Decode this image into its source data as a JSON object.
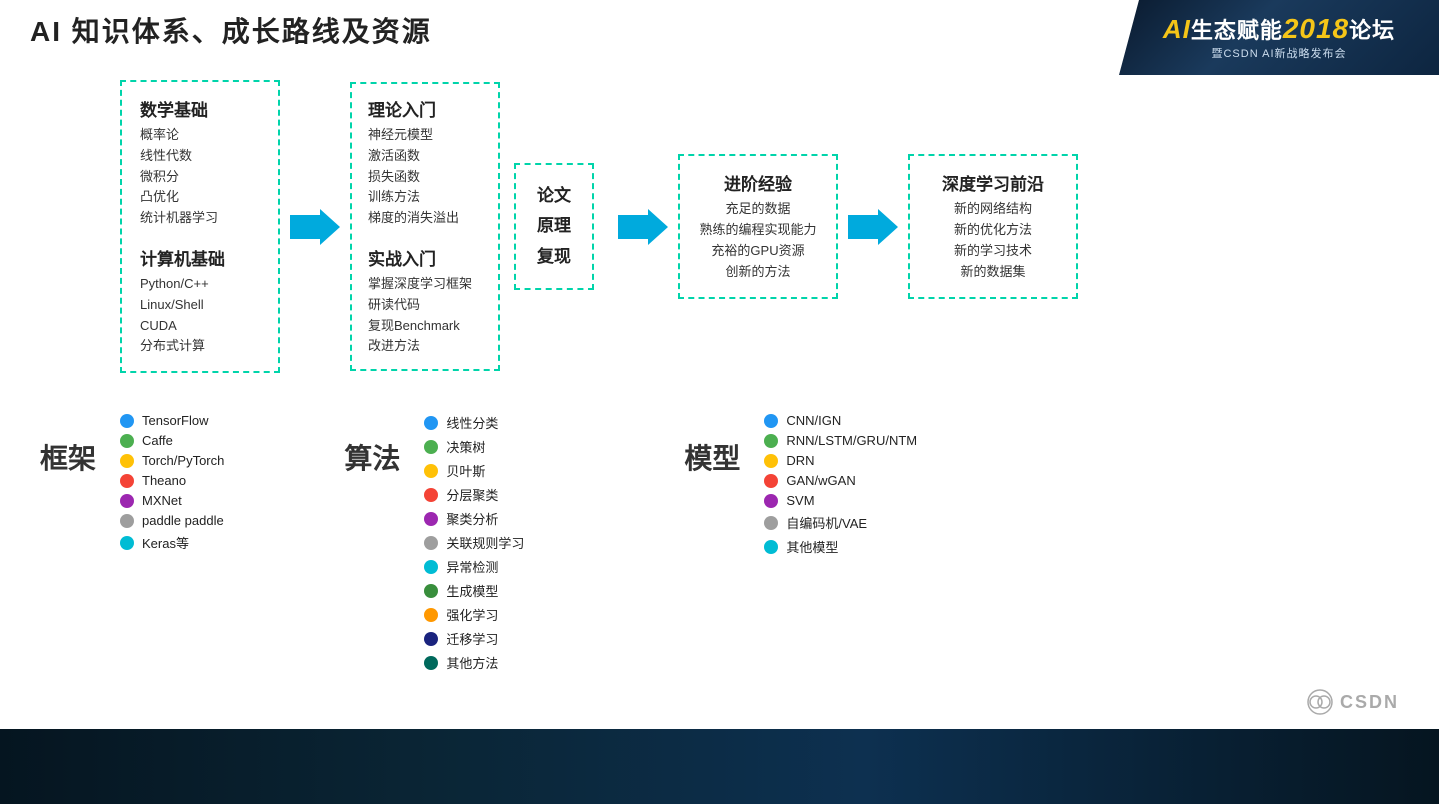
{
  "header": {
    "title": "AI 知识体系、成长路线及资源"
  },
  "logo": {
    "main_prefix": "AI",
    "main_text": "生态赋能",
    "year": "2018",
    "suffix": "论坛",
    "subtitle": "暨CSDN AI新战略发布会"
  },
  "flow": {
    "box1": {
      "sections": [
        {
          "title": "数学基础",
          "items": [
            "概率论",
            "线性代数",
            "微积分",
            "凸优化",
            "统计机器学习"
          ]
        },
        {
          "title": "计算机基础",
          "items": [
            "Python/C++",
            "Linux/Shell",
            "CUDA",
            "分布式计算"
          ]
        }
      ]
    },
    "box2": {
      "sections": [
        {
          "title": "理论入门",
          "items": [
            "神经元模型",
            "激活函数",
            "损失函数",
            "训练方法",
            "梯度的消失溢出"
          ]
        },
        {
          "title": "实战入门",
          "items": [
            "掌握深度学习框架",
            "研读代码",
            "复现Benchmark",
            "改进方法"
          ]
        }
      ]
    },
    "paper_box": {
      "lines": [
        "论文",
        "原理",
        "复现"
      ]
    },
    "box3": {
      "title": "进阶经验",
      "items": [
        "充足的数据",
        "熟练的编程实现能力",
        "充裕的GPU资源",
        "创新的方法"
      ]
    },
    "box4": {
      "title": "深度学习前沿",
      "items": [
        "新的网络结构",
        "新的优化方法",
        "新的学习技术",
        "新的数据集"
      ]
    }
  },
  "framework": {
    "label": "框架",
    "items": [
      {
        "color": "#2196F3",
        "name": "TensorFlow"
      },
      {
        "color": "#4CAF50",
        "name": "Caffe"
      },
      {
        "color": "#FFC107",
        "name": "Torch/PyTorch"
      },
      {
        "color": "#F44336",
        "name": "Theano"
      },
      {
        "color": "#9C27B0",
        "name": "MXNet"
      },
      {
        "color": "#9E9E9E",
        "name": "paddle paddle"
      },
      {
        "color": "#00BCD4",
        "name": "Keras等"
      }
    ]
  },
  "algorithm": {
    "label": "算法",
    "items": [
      {
        "color": "#2196F3",
        "name": "线性分类"
      },
      {
        "color": "#4CAF50",
        "name": "决策树"
      },
      {
        "color": "#FFC107",
        "name": "贝叶斯"
      },
      {
        "color": "#F44336",
        "name": "分层聚类"
      },
      {
        "color": "#9C27B0",
        "name": "聚类分析"
      },
      {
        "color": "#9E9E9E",
        "name": "关联规则学习"
      },
      {
        "color": "#00BCD4",
        "name": "异常检测"
      },
      {
        "color": "#388E3C",
        "name": "生成模型"
      },
      {
        "color": "#FF9800",
        "name": "强化学习"
      },
      {
        "color": "#1A237E",
        "name": "迁移学习"
      },
      {
        "color": "#00695C",
        "name": "其他方法"
      }
    ]
  },
  "model": {
    "label": "模型",
    "items": [
      {
        "color": "#2196F3",
        "name": "CNN/IGN"
      },
      {
        "color": "#4CAF50",
        "name": "RNN/LSTM/GRU/NTM"
      },
      {
        "color": "#FFC107",
        "name": "DRN"
      },
      {
        "color": "#F44336",
        "name": "GAN/wGAN"
      },
      {
        "color": "#9C27B0",
        "name": "SVM"
      },
      {
        "color": "#9E9E9E",
        "name": "自编码机/VAE"
      },
      {
        "color": "#00BCD4",
        "name": "其他模型"
      }
    ]
  },
  "watermark": {
    "csdn": "CSDN"
  }
}
